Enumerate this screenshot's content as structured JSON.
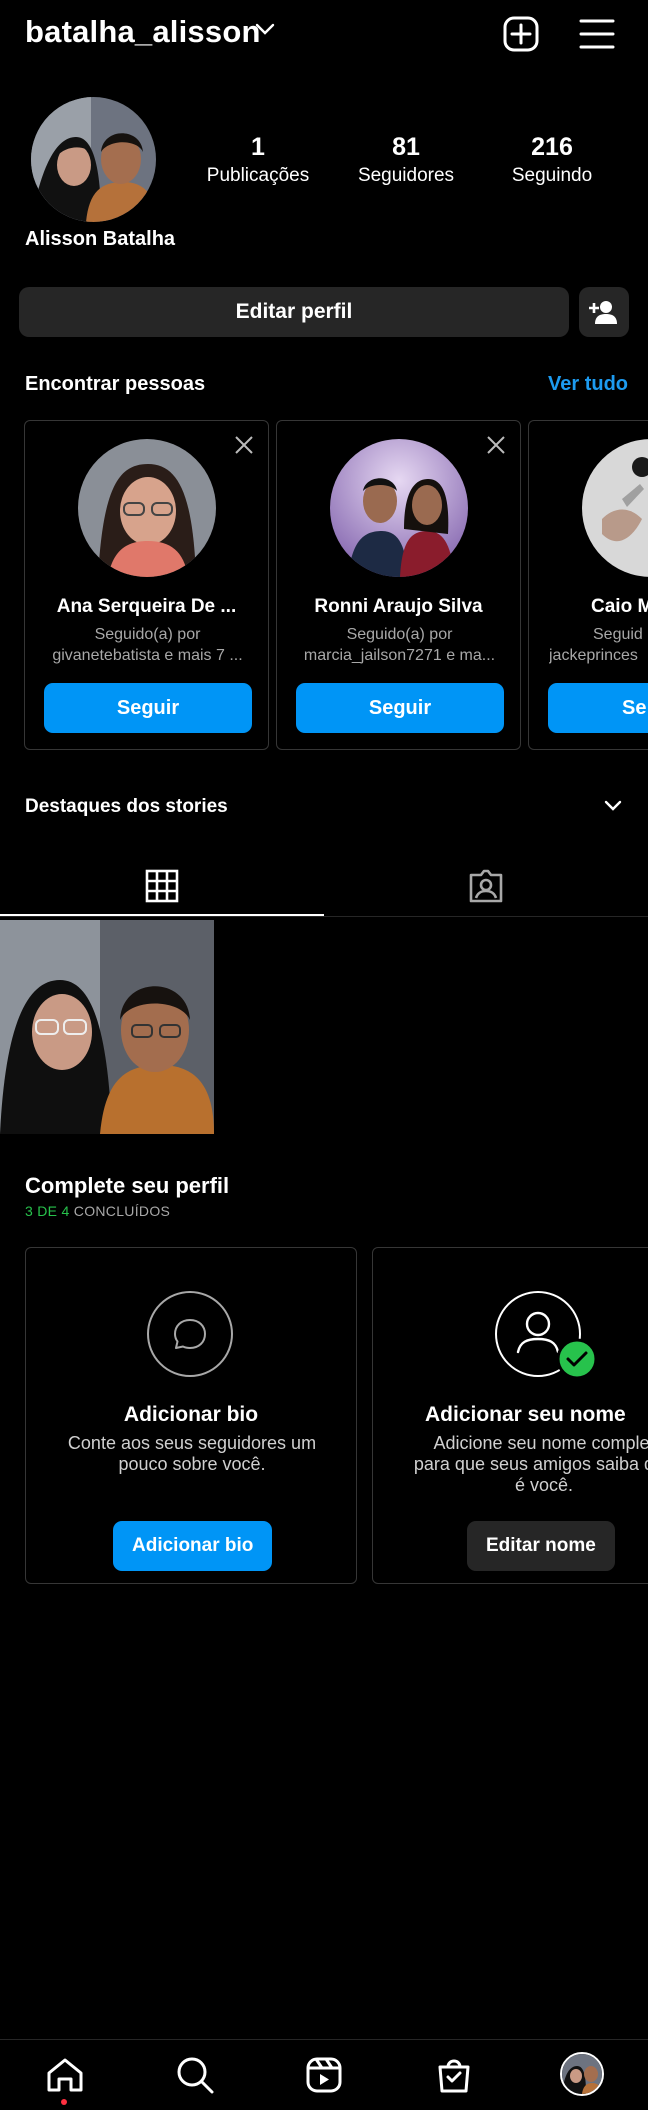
{
  "header": {
    "username": "batalha_alisson"
  },
  "profile": {
    "full_name": "Alisson Batalha",
    "stats": [
      {
        "value": "1",
        "label": "Publicações"
      },
      {
        "value": "81",
        "label": "Seguidores"
      },
      {
        "value": "216",
        "label": "Seguindo"
      }
    ],
    "edit_profile_label": "Editar perfil"
  },
  "discover": {
    "title": "Encontrar pessoas",
    "see_all": "Ver tudo",
    "cards": [
      {
        "name": "Ana Serqueira De ...",
        "line1": "Seguido(a) por",
        "line2": "givanetebatista e mais 7 ...",
        "button": "Seguir"
      },
      {
        "name": "Ronni Araujo Silva",
        "line1": "Seguido(a) por",
        "line2": "marcia_jailson7271 e ma...",
        "button": "Seguir"
      },
      {
        "name": "Caio M",
        "line1": "Seguid",
        "line2": "jackeprinces",
        "button": "Se"
      }
    ]
  },
  "highlights": {
    "title": "Destaques dos stories"
  },
  "complete": {
    "title": "Complete seu perfil",
    "progress_count": "3 DE 4",
    "progress_label": " CONCLUÍDOS",
    "cards": [
      {
        "title": "Adicionar bio",
        "desc": "Conte aos seus seguidores um pouco sobre você.",
        "button": "Adicionar bio"
      },
      {
        "title": "Adicionar seu nome",
        "desc": "Adicione seu nome complet para que seus amigos saiba que é você.",
        "button": "Editar nome"
      }
    ]
  },
  "colors": {
    "accent": "#0095f6",
    "link": "#1d9bf0",
    "success": "#27c24c",
    "card_bg": "#262626"
  }
}
